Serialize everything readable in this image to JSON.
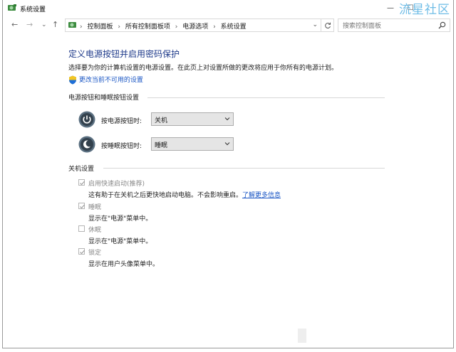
{
  "window": {
    "title": "系统设置",
    "watermark": "流星社区",
    "caption": {
      "minimize": "—",
      "maximize": "☐"
    }
  },
  "nav": {
    "back": "←",
    "forward": "→",
    "recent": "⌄",
    "up": "↑",
    "breadcrumbs": [
      "控制面板",
      "所有控制面板项",
      "电源选项",
      "系统设置"
    ],
    "separator": "›",
    "search_placeholder": "搜索控制面板"
  },
  "page": {
    "heading": "定义电源按钮并启用密码保护",
    "description": "选择要为你的计算机设置的电源设置。在此页上对设置所做的更改将应用于你所有的电源计划。",
    "change_link": "更改当前不可用的设置"
  },
  "power_buttons": {
    "section_title": "电源按钮和睡眠按钮设置",
    "rows": [
      {
        "label": "按电源按钮时:",
        "value": "关机",
        "icon": "power-icon"
      },
      {
        "label": "按睡眠按钮时:",
        "value": "睡眠",
        "icon": "sleep-moon-icon"
      }
    ]
  },
  "shutdown": {
    "section_title": "关机设置",
    "items": [
      {
        "label": "启用快速启动(推荐)",
        "checked": true,
        "desc": "这有助于在关机之后更快地启动电脑。不会影响重启。",
        "link": "了解更多信息"
      },
      {
        "label": "睡眠",
        "checked": true,
        "desc": "显示在\"电源\"菜单中。"
      },
      {
        "label": "休眠",
        "checked": false,
        "desc": "显示在\"电源\"菜单中。"
      },
      {
        "label": "锁定",
        "checked": true,
        "desc": "显示在用户头像菜单中。"
      }
    ]
  },
  "colors": {
    "heading": "#1e3a8a",
    "link": "#1a56c4",
    "watermark": "#5fb5e4"
  }
}
